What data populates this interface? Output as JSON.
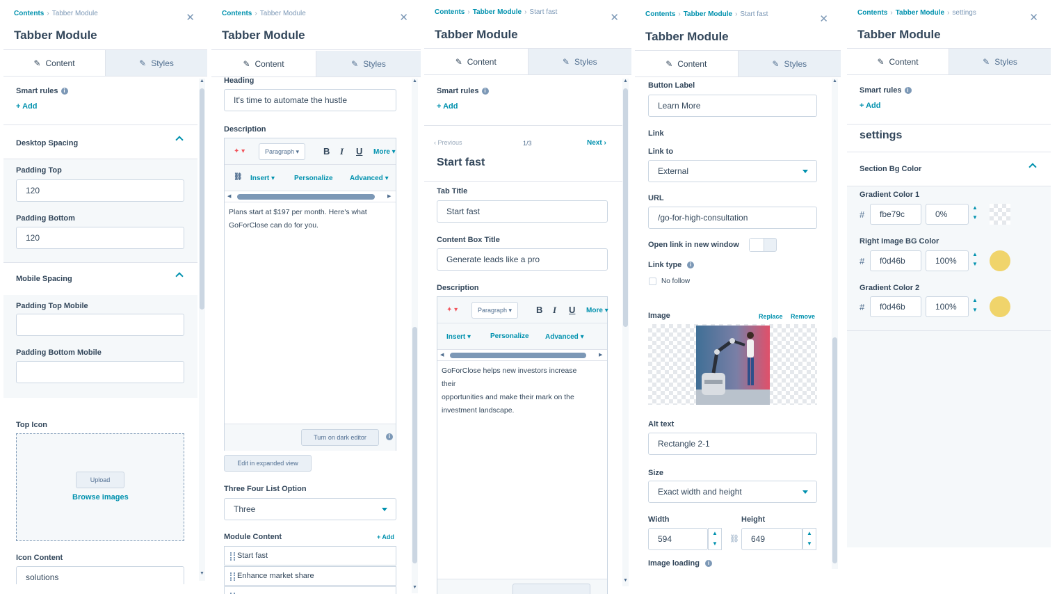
{
  "common": {
    "crumb_root": "Contents",
    "crumb_module": "Tabber Module",
    "title": "Tabber Module",
    "tab_content": "Content",
    "tab_styles": "Styles",
    "smart_rules": "Smart rules",
    "add": "Add",
    "add_plus": "+ Add"
  },
  "p1": {
    "desktop_spacing": "Desktop Spacing",
    "padding_top": "Padding Top",
    "padding_top_value": "120",
    "padding_bottom": "Padding Bottom",
    "padding_bottom_value": "120",
    "mobile_spacing": "Mobile Spacing",
    "padding_top_mobile": "Padding Top Mobile",
    "padding_bottom_mobile": "Padding Bottom Mobile",
    "top_icon": "Top Icon",
    "upload": "Upload",
    "browse_images": "Browse images",
    "icon_content": "Icon Content",
    "icon_content_value": "solutions"
  },
  "p2": {
    "heading_label": "Heading",
    "heading_value": "It's time to automate the hustle",
    "description_label": "Description",
    "paragraph": "Paragraph",
    "bold": "B",
    "italic": "I",
    "underline": "U",
    "more": "More",
    "insert": "Insert",
    "personalize": "Personalize",
    "advanced": "Advanced",
    "body_line1": "Plans start at $197 per month. Here's what",
    "body_line2": "GoForClose can do for you.",
    "dark_editor": "Turn on dark editor",
    "expanded_view": "Edit in expanded view",
    "list_option_label": "Three Four List Option",
    "list_option_value": "Three",
    "module_content": "Module Content",
    "items": [
      "Start fast",
      "Enhance market share"
    ]
  },
  "p3": {
    "crumb_leaf": "Start fast",
    "previous": "Previous",
    "pager": "1/3",
    "next": "Next",
    "item_title": "Start fast",
    "tab_title_label": "Tab Title",
    "tab_title_value": "Start fast",
    "box_title_label": "Content Box Title",
    "box_title_value": "Generate leads like a pro",
    "description_label": "Description",
    "body_line1": "GoForClose helps new investors increase",
    "body_line2": "their",
    "body_line3": "opportunities and make their mark on the",
    "body_line4": "investment landscape."
  },
  "p4": {
    "crumb_leaf": "Start fast",
    "button_label": "Button Label",
    "button_label_value": "Learn More",
    "link": "Link",
    "link_to": "Link to",
    "link_to_value": "External",
    "url_label": "URL",
    "url_value": "/go-for-high-consultation",
    "new_window": "Open link in new window",
    "link_type": "Link type",
    "no_follow": "No follow",
    "image": "Image",
    "replace": "Replace",
    "remove": "Remove",
    "alt_text": "Alt text",
    "alt_text_value": "Rectangle 2-1",
    "size": "Size",
    "size_value": "Exact width and height",
    "width": "Width",
    "width_value": "594",
    "height": "Height",
    "height_value": "649",
    "image_loading": "Image loading"
  },
  "p5": {
    "crumb_leaf": "settings",
    "settings": "settings",
    "section_bg": "Section Bg Color",
    "gradient1": "Gradient Color 1",
    "gradient1_hex": "fbe79c",
    "gradient1_opacity": "0%",
    "right_bg": "Right Image BG Color",
    "right_bg_hex": "f0d46b",
    "right_bg_opacity": "100%",
    "gradient2": "Gradient Color 2",
    "gradient2_hex": "f0d46b",
    "gradient2_opacity": "100%",
    "hash": "#",
    "swatch_color": "#f0d46b"
  },
  "colors": {
    "accent": "#0091ae",
    "text": "#33475b",
    "border": "#cbd6e2"
  }
}
